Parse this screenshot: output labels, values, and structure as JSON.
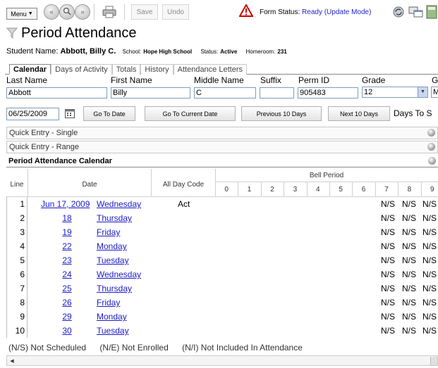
{
  "toolbar": {
    "menu_label": "Menu",
    "save_label": "Save",
    "undo_label": "Undo",
    "form_status_label": "Form Status:",
    "form_status_value": "Ready (Update Mode)"
  },
  "page": {
    "title": "Period Attendance"
  },
  "student": {
    "name_label": "Student Name:",
    "name": "Abbott, Billy C.",
    "school_label": "School:",
    "school": "Hope High School",
    "status_label": "Status:",
    "status": "Active",
    "homeroom_label": "Homeroom:",
    "homeroom": "231"
  },
  "tabs": [
    {
      "label": "Calendar"
    },
    {
      "label": "Days of Activity"
    },
    {
      "label": "Totals"
    },
    {
      "label": "History"
    },
    {
      "label": "Attendance Letters"
    }
  ],
  "fields": {
    "last_name": {
      "label": "Last Name",
      "value": "Abbott"
    },
    "first_name": {
      "label": "First Name",
      "value": "Billy"
    },
    "middle_name": {
      "label": "Middle Name",
      "value": "C"
    },
    "suffix": {
      "label": "Suffix",
      "value": ""
    },
    "perm_id": {
      "label": "Perm ID",
      "value": "905483"
    },
    "grade": {
      "label": "Grade",
      "value": "12"
    },
    "gender": {
      "label": "G",
      "value": "M"
    }
  },
  "date_nav": {
    "date_value": "06/25/2009",
    "go_to_date": "Go To Date",
    "go_to_current": "Go To Current Date",
    "previous": "Previous 10 Days",
    "next": "Next 10 Days",
    "days_to": "Days To S"
  },
  "sections": {
    "quick_single": "Quick Entry - Single",
    "quick_range": "Quick Entry - Range",
    "calendar_title": "Period Attendance Calendar"
  },
  "table": {
    "col_line": "Line",
    "col_date": "Date",
    "col_all_day": "All Day Code",
    "col_bell": "Bell Period",
    "periods": [
      "0",
      "1",
      "2",
      "3",
      "4",
      "5",
      "6",
      "7",
      "8",
      "9"
    ],
    "rows": [
      {
        "line": "1",
        "date": "Jun 17, 2009",
        "day": "Wednesday",
        "code": "Act",
        "p7": "N/S",
        "p8": "N/S",
        "p9": "N/S"
      },
      {
        "line": "2",
        "date": "18",
        "day": "Thursday",
        "code": "",
        "p7": "N/S",
        "p8": "N/S",
        "p9": "N/S"
      },
      {
        "line": "3",
        "date": "19",
        "day": "Friday",
        "code": "",
        "p7": "N/S",
        "p8": "N/S",
        "p9": "N/S"
      },
      {
        "line": "4",
        "date": "22",
        "day": "Monday",
        "code": "",
        "p7": "N/S",
        "p8": "N/S",
        "p9": "N/S"
      },
      {
        "line": "5",
        "date": "23",
        "day": "Tuesday",
        "code": "",
        "p7": "N/S",
        "p8": "N/S",
        "p9": "N/S"
      },
      {
        "line": "6",
        "date": "24",
        "day": "Wednesday",
        "code": "",
        "p7": "N/S",
        "p8": "N/S",
        "p9": "N/S"
      },
      {
        "line": "7",
        "date": "25",
        "day": "Thursday",
        "code": "",
        "p7": "N/S",
        "p8": "N/S",
        "p9": "N/S"
      },
      {
        "line": "8",
        "date": "26",
        "day": "Friday",
        "code": "",
        "p7": "N/S",
        "p8": "N/S",
        "p9": "N/S"
      },
      {
        "line": "9",
        "date": "29",
        "day": "Monday",
        "code": "",
        "p7": "N/S",
        "p8": "N/S",
        "p9": "N/S"
      },
      {
        "line": "10",
        "date": "30",
        "day": "Tuesday",
        "code": "",
        "p7": "N/S",
        "p8": "N/S",
        "p9": "N/S"
      }
    ]
  },
  "legend": {
    "ns": "(N/S) Not Scheduled",
    "ne": "(N/E) Not Enrolled",
    "ni": "(N/I) Not Included In Attendance"
  },
  "icons": {
    "back": "back-arrow-icon",
    "search": "search-icon",
    "forward": "forward-arrow-icon",
    "print": "printer-icon",
    "warning": "warning-icon",
    "calendar": "calendar-picker-icon"
  },
  "colors": {
    "link": "#1a1ac8",
    "status_value": "#1f1fd1",
    "warning": "#cc0000"
  }
}
